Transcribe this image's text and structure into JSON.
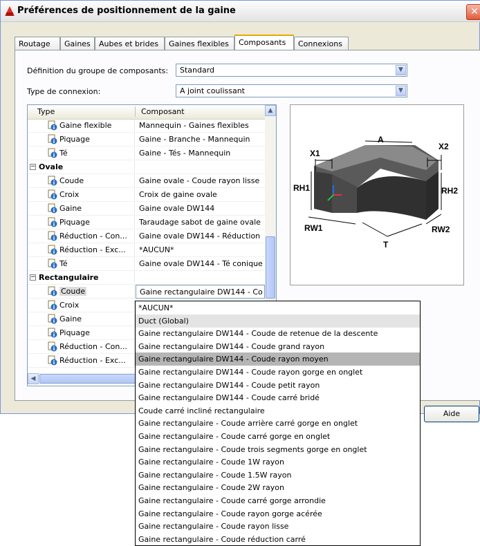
{
  "window": {
    "title": "Préférences de positionnement de la gaine",
    "close_glyph": "✕"
  },
  "tabs": [
    "Routage",
    "Gaines",
    "Aubes et brides",
    "Gaines flexibles",
    "Composants",
    "Connexions"
  ],
  "active_tab": "Composants",
  "group_definition": {
    "label": "Définition du groupe de composants:",
    "value": "Standard"
  },
  "connection_type": {
    "label": "Type de connexion:",
    "value": "A joint coulissant"
  },
  "grid": {
    "col_type": "Type",
    "col_component": "Composant",
    "rows": [
      {
        "kind": "item",
        "type": "Gaine flexible",
        "component": "Mannequin - Gaines flexibles"
      },
      {
        "kind": "item",
        "type": "Piquage",
        "component": "Gaine - Branche - Mannequin"
      },
      {
        "kind": "item",
        "type": "Té",
        "component": "Gaine - Tés - Mannequin"
      },
      {
        "kind": "category",
        "type": "Ovale",
        "component": ""
      },
      {
        "kind": "item",
        "type": "Coude",
        "component": "Gaine ovale - Coude rayon lisse"
      },
      {
        "kind": "item",
        "type": "Croix",
        "component": "Croix de gaine ovale"
      },
      {
        "kind": "item",
        "type": "Gaine",
        "component": "Gaine ovale DW144"
      },
      {
        "kind": "item",
        "type": "Piquage",
        "component": "Taraudage sabot de gaine ovale"
      },
      {
        "kind": "item",
        "type": "Réduction - Con...",
        "component": "Gaine ovale DW144 - Réduction"
      },
      {
        "kind": "item",
        "type": "Réduction - Exc...",
        "component": "*AUCUN*"
      },
      {
        "kind": "item",
        "type": "Té",
        "component": "Gaine ovale DW144 - Té conique"
      },
      {
        "kind": "category",
        "type": "Rectangulaire",
        "component": ""
      },
      {
        "kind": "item",
        "type": "Coude",
        "component": "Gaine rectangulaire DW144 - Co",
        "selected": true
      },
      {
        "kind": "item",
        "type": "Croix",
        "component": ""
      },
      {
        "kind": "item",
        "type": "Gaine",
        "component": ""
      },
      {
        "kind": "item",
        "type": "Piquage",
        "component": ""
      },
      {
        "kind": "item",
        "type": "Réduction - Con...",
        "component": ""
      },
      {
        "kind": "item",
        "type": "Réduction - Exc...",
        "component": ""
      }
    ]
  },
  "preview_labels": {
    "a": "A",
    "x1": "X1",
    "x2": "X2",
    "rh1": "RH1",
    "rh2": "RH2",
    "rw1": "RW1",
    "rw2": "RW2",
    "t": "T"
  },
  "buttons": {
    "help": "Aide"
  },
  "dropdown": {
    "selected_index": 3,
    "highlighted_index": 1,
    "options": [
      "*AUCUN*",
      "Duct (Global)",
      "Gaine rectangulaire DW144 - Coude de retenue de la descente",
      "Gaine rectangulaire DW144 - Coude grand rayon",
      "Gaine rectangulaire DW144 - Coude rayon moyen",
      "Gaine rectangulaire DW144 - Coude rayon gorge en onglet",
      "Gaine rectangulaire DW144 - Coude petit rayon",
      "Gaine rectangulaire DW144 - Coude carré bridé",
      "Coude carré incliné rectangulaire",
      "Gaine rectangulaire - Coude arrière carré gorge en onglet",
      "Gaine rectangulaire - Coude carré gorge en onglet",
      "Gaine rectangulaire - Coude trois segments gorge en onglet",
      "Gaine rectangulaire - Coude 1W rayon",
      "Gaine rectangulaire - Coude 1.5W rayon",
      "Gaine rectangulaire - Coude 2W rayon",
      "Gaine rectangulaire - Coude carré gorge arrondie",
      "Gaine rectangulaire - Coude rayon gorge acérée",
      "Gaine rectangulaire - Coude rayon lisse",
      "Gaine rectangulaire - Coude réduction carré"
    ]
  },
  "colors": {
    "accent_tab": "#e8a800",
    "selection": "#b5b5b5",
    "info_icon": "#2f6fc0"
  }
}
